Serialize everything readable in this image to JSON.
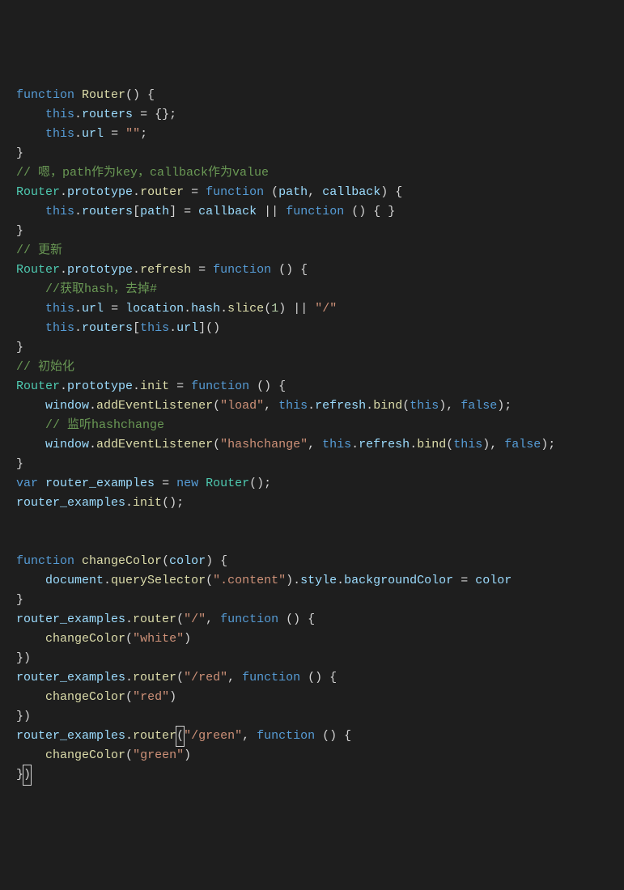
{
  "code": {
    "tokens": [
      [
        "kw",
        "function"
      ],
      [
        "pun",
        " "
      ],
      [
        "fn",
        "Router"
      ],
      [
        "pun",
        "() {\n    "
      ],
      [
        "th",
        "this"
      ],
      [
        "pun",
        "."
      ],
      [
        "prop",
        "routers"
      ],
      [
        "pun",
        " "
      ],
      [
        "op",
        "="
      ],
      [
        "pun",
        " {};\n    "
      ],
      [
        "th",
        "this"
      ],
      [
        "pun",
        "."
      ],
      [
        "prop",
        "url"
      ],
      [
        "pun",
        " "
      ],
      [
        "op",
        "="
      ],
      [
        "pun",
        " "
      ],
      [
        "str",
        "\"\""
      ],
      [
        "pun",
        ";\n}\n"
      ],
      [
        "cm",
        "// 嗯，path作为key，callback作为value"
      ],
      [
        "pun",
        "\n"
      ],
      [
        "cls",
        "Router"
      ],
      [
        "pun",
        "."
      ],
      [
        "prop",
        "prototype"
      ],
      [
        "pun",
        "."
      ],
      [
        "fn",
        "router"
      ],
      [
        "pun",
        " "
      ],
      [
        "op",
        "="
      ],
      [
        "pun",
        " "
      ],
      [
        "kw",
        "function"
      ],
      [
        "pun",
        " ("
      ],
      [
        "prm",
        "path"
      ],
      [
        "pun",
        ", "
      ],
      [
        "prm",
        "callback"
      ],
      [
        "pun",
        ") {\n    "
      ],
      [
        "th",
        "this"
      ],
      [
        "pun",
        "."
      ],
      [
        "prop",
        "routers"
      ],
      [
        "pun",
        "["
      ],
      [
        "prm",
        "path"
      ],
      [
        "pun",
        "] "
      ],
      [
        "op",
        "="
      ],
      [
        "pun",
        " "
      ],
      [
        "prm",
        "callback"
      ],
      [
        "pun",
        " "
      ],
      [
        "op",
        "||"
      ],
      [
        "pun",
        " "
      ],
      [
        "kw",
        "function"
      ],
      [
        "pun",
        " () { }\n}\n"
      ],
      [
        "cm",
        "// 更新"
      ],
      [
        "pun",
        "\n"
      ],
      [
        "cls",
        "Router"
      ],
      [
        "pun",
        "."
      ],
      [
        "prop",
        "prototype"
      ],
      [
        "pun",
        "."
      ],
      [
        "fn",
        "refresh"
      ],
      [
        "pun",
        " "
      ],
      [
        "op",
        "="
      ],
      [
        "pun",
        " "
      ],
      [
        "kw",
        "function"
      ],
      [
        "pun",
        " () {\n    "
      ],
      [
        "cm",
        "//获取hash，去掉#"
      ],
      [
        "pun",
        "\n    "
      ],
      [
        "th",
        "this"
      ],
      [
        "pun",
        "."
      ],
      [
        "prop",
        "url"
      ],
      [
        "pun",
        " "
      ],
      [
        "op",
        "="
      ],
      [
        "pun",
        " "
      ],
      [
        "prm",
        "location"
      ],
      [
        "pun",
        "."
      ],
      [
        "prop",
        "hash"
      ],
      [
        "pun",
        "."
      ],
      [
        "fn",
        "slice"
      ],
      [
        "pun",
        "("
      ],
      [
        "num",
        "1"
      ],
      [
        "pun",
        ") "
      ],
      [
        "op",
        "||"
      ],
      [
        "pun",
        " "
      ],
      [
        "str",
        "\"/\""
      ],
      [
        "pun",
        "\n    "
      ],
      [
        "th",
        "this"
      ],
      [
        "pun",
        "."
      ],
      [
        "prop",
        "routers"
      ],
      [
        "pun",
        "["
      ],
      [
        "th",
        "this"
      ],
      [
        "pun",
        "."
      ],
      [
        "prop",
        "url"
      ],
      [
        "pun",
        "]()\n}\n"
      ],
      [
        "cm",
        "// 初始化"
      ],
      [
        "pun",
        "\n"
      ],
      [
        "cls",
        "Router"
      ],
      [
        "pun",
        "."
      ],
      [
        "prop",
        "prototype"
      ],
      [
        "pun",
        "."
      ],
      [
        "fn",
        "init"
      ],
      [
        "pun",
        " "
      ],
      [
        "op",
        "="
      ],
      [
        "pun",
        " "
      ],
      [
        "kw",
        "function"
      ],
      [
        "pun",
        " () {\n    "
      ],
      [
        "prm",
        "window"
      ],
      [
        "pun",
        "."
      ],
      [
        "fn",
        "addEventListener"
      ],
      [
        "pun",
        "("
      ],
      [
        "str",
        "\"load\""
      ],
      [
        "pun",
        ", "
      ],
      [
        "th",
        "this"
      ],
      [
        "pun",
        "."
      ],
      [
        "prop",
        "refresh"
      ],
      [
        "pun",
        "."
      ],
      [
        "fn",
        "bind"
      ],
      [
        "pun",
        "("
      ],
      [
        "th",
        "this"
      ],
      [
        "pun",
        "), "
      ],
      [
        "bool",
        "false"
      ],
      [
        "pun",
        ");\n    "
      ],
      [
        "cm",
        "// 监听hashchange"
      ],
      [
        "pun",
        "\n    "
      ],
      [
        "prm",
        "window"
      ],
      [
        "pun",
        "."
      ],
      [
        "fn",
        "addEventListener"
      ],
      [
        "pun",
        "("
      ],
      [
        "str",
        "\"hashchange\""
      ],
      [
        "pun",
        ", "
      ],
      [
        "th",
        "this"
      ],
      [
        "pun",
        "."
      ],
      [
        "prop",
        "refresh"
      ],
      [
        "pun",
        "."
      ],
      [
        "fn",
        "bind"
      ],
      [
        "pun",
        "("
      ],
      [
        "th",
        "this"
      ],
      [
        "pun",
        "), "
      ],
      [
        "bool",
        "false"
      ],
      [
        "pun",
        ");\n}\n"
      ],
      [
        "kw",
        "var"
      ],
      [
        "pun",
        " "
      ],
      [
        "prm",
        "router_examples"
      ],
      [
        "pun",
        " "
      ],
      [
        "op",
        "="
      ],
      [
        "pun",
        " "
      ],
      [
        "kw",
        "new"
      ],
      [
        "pun",
        " "
      ],
      [
        "cls",
        "Router"
      ],
      [
        "pun",
        "();\n"
      ],
      [
        "prm",
        "router_examples"
      ],
      [
        "pun",
        "."
      ],
      [
        "fn",
        "init"
      ],
      [
        "pun",
        "();\n\n\n"
      ],
      [
        "kw",
        "function"
      ],
      [
        "pun",
        " "
      ],
      [
        "fn",
        "changeColor"
      ],
      [
        "pun",
        "("
      ],
      [
        "prm",
        "color"
      ],
      [
        "pun",
        ") {\n    "
      ],
      [
        "prm",
        "document"
      ],
      [
        "pun",
        "."
      ],
      [
        "fn",
        "querySelector"
      ],
      [
        "pun",
        "("
      ],
      [
        "str",
        "\".content\""
      ],
      [
        "pun",
        ")."
      ],
      [
        "prop",
        "style"
      ],
      [
        "pun",
        "."
      ],
      [
        "prop",
        "backgroundColor"
      ],
      [
        "pun",
        " "
      ],
      [
        "op",
        "="
      ],
      [
        "pun",
        " "
      ],
      [
        "prm",
        "color"
      ],
      [
        "pun",
        "\n}\n"
      ],
      [
        "prm",
        "router_examples"
      ],
      [
        "pun",
        "."
      ],
      [
        "fn",
        "router"
      ],
      [
        "pun",
        "("
      ],
      [
        "str",
        "\"/\""
      ],
      [
        "pun",
        ", "
      ],
      [
        "kw",
        "function"
      ],
      [
        "pun",
        " () {\n    "
      ],
      [
        "fn",
        "changeColor"
      ],
      [
        "pun",
        "("
      ],
      [
        "str",
        "\"white\""
      ],
      [
        "pun",
        ")\n})\n"
      ],
      [
        "prm",
        "router_examples"
      ],
      [
        "pun",
        "."
      ],
      [
        "fn",
        "router"
      ],
      [
        "pun",
        "("
      ],
      [
        "str",
        "\"/red\""
      ],
      [
        "pun",
        ", "
      ],
      [
        "kw",
        "function"
      ],
      [
        "pun",
        " () {\n    "
      ],
      [
        "fn",
        "changeColor"
      ],
      [
        "pun",
        "("
      ],
      [
        "str",
        "\"red\""
      ],
      [
        "pun",
        ")\n})\n"
      ],
      [
        "prm",
        "router_examples"
      ],
      [
        "pun",
        "."
      ],
      [
        "fn",
        "router"
      ],
      [
        "cursor",
        "("
      ],
      [
        "str",
        "\"/green\""
      ],
      [
        "pun",
        ", "
      ],
      [
        "kw",
        "function"
      ],
      [
        "pun",
        " () {\n    "
      ],
      [
        "fn",
        "changeColor"
      ],
      [
        "pun",
        "("
      ],
      [
        "str",
        "\"green\""
      ],
      [
        "pun",
        ")\n}"
      ],
      [
        "cursor",
        ")"
      ]
    ]
  }
}
